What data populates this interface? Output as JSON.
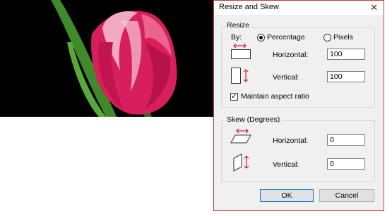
{
  "dialog": {
    "title": "Resize and Skew",
    "close_glyph": "✕"
  },
  "resize": {
    "group_label": "Resize",
    "by_label": "By:",
    "percentage_label": "Percentage",
    "pixels_label": "Pixels",
    "selected_mode": "Percentage",
    "horizontal_label": "Horizontal:",
    "horizontal_value": "100",
    "vertical_label": "Vertical:",
    "vertical_value": "100",
    "maintain_label": "Maintain aspect ratio",
    "maintain_checked": true,
    "checkmark": "✓"
  },
  "skew": {
    "group_label": "Skew (Degrees)",
    "horizontal_label": "Horizontal:",
    "horizontal_value": "0",
    "vertical_label": "Vertical:",
    "vertical_value": "0"
  },
  "buttons": {
    "ok": "OK",
    "cancel": "Cancel"
  },
  "colors": {
    "accent_red": "#d41f1f",
    "default_button_border": "#0078d7"
  }
}
